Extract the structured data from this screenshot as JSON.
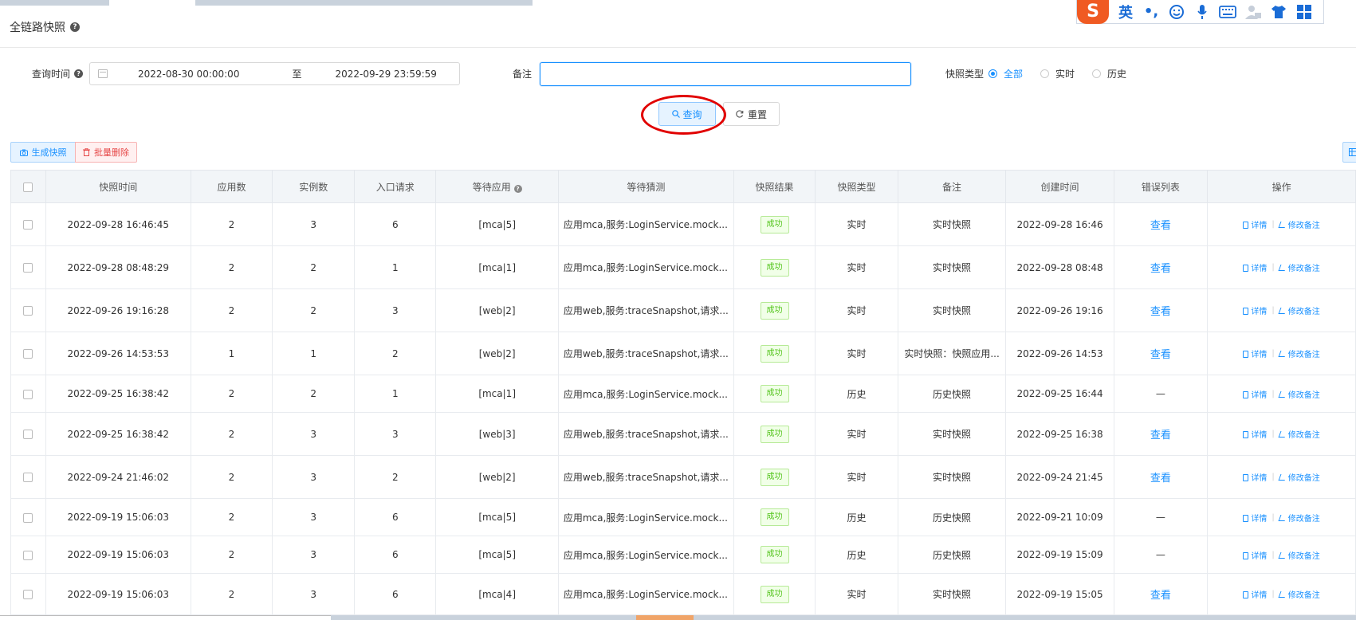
{
  "page": {
    "title": "全链路快照"
  },
  "filters": {
    "time_label": "查询时间",
    "date_start": "2022-08-30 00:00:00",
    "date_sep": "至",
    "date_end": "2022-09-29 23:59:59",
    "remark_label": "备注",
    "remark_value": "",
    "type_label": "快照类型",
    "type_options": [
      "全部",
      "实时",
      "历史"
    ],
    "type_selected": "全部"
  },
  "buttons": {
    "query": "查询",
    "reset": "重置",
    "generate": "生成快照",
    "batch_delete": "批量删除"
  },
  "ime": {
    "logo": "S",
    "lang": "英"
  },
  "table": {
    "columns": [
      "快照时间",
      "应用数",
      "实例数",
      "入口请求",
      "等待应用",
      "等待猜测",
      "快照结果",
      "快照类型",
      "备注",
      "创建时间",
      "错误列表",
      "操作"
    ],
    "ops": {
      "detail": "详情",
      "edit": "修改备注"
    },
    "rows": [
      {
        "time": "2022-09-28 16:46:45",
        "apps": "2",
        "instances": "3",
        "requests": "6",
        "wait_app": "[mca|5]",
        "guess": "应用mca,服务:LoginService.mock...",
        "result": "成功",
        "type": "实时",
        "remark": "实时快照",
        "created": "2022-09-28 16:46",
        "errors": "查看"
      },
      {
        "time": "2022-09-28 08:48:29",
        "apps": "2",
        "instances": "2",
        "requests": "1",
        "wait_app": "[mca|1]",
        "guess": "应用mca,服务:LoginService.mock...",
        "result": "成功",
        "type": "实时",
        "remark": "实时快照",
        "created": "2022-09-28 08:48",
        "errors": "查看"
      },
      {
        "time": "2022-09-26 19:16:28",
        "apps": "2",
        "instances": "2",
        "requests": "3",
        "wait_app": "[web|2]",
        "guess": "应用web,服务:traceSnapshot,请求...",
        "result": "成功",
        "type": "实时",
        "remark": "实时快照",
        "created": "2022-09-26 19:16",
        "errors": "查看"
      },
      {
        "time": "2022-09-26 14:53:53",
        "apps": "1",
        "instances": "1",
        "requests": "2",
        "wait_app": "[web|2]",
        "guess": "应用web,服务:traceSnapshot,请求...",
        "result": "成功",
        "type": "实时",
        "remark": "实时快照：快照应用...",
        "created": "2022-09-26 14:53",
        "errors": "查看"
      },
      {
        "time": "2022-09-25 16:38:42",
        "apps": "2",
        "instances": "2",
        "requests": "1",
        "wait_app": "[mca|1]",
        "guess": "应用mca,服务:LoginService.mock...",
        "result": "成功",
        "type": "历史",
        "remark": "历史快照",
        "created": "2022-09-25 16:44",
        "errors": "—"
      },
      {
        "time": "2022-09-25 16:38:42",
        "apps": "2",
        "instances": "3",
        "requests": "3",
        "wait_app": "[web|3]",
        "guess": "应用web,服务:traceSnapshot,请求...",
        "result": "成功",
        "type": "实时",
        "remark": "实时快照",
        "created": "2022-09-25 16:38",
        "errors": "查看"
      },
      {
        "time": "2022-09-24 21:46:02",
        "apps": "2",
        "instances": "3",
        "requests": "2",
        "wait_app": "[web|2]",
        "guess": "应用web,服务:traceSnapshot,请求...",
        "result": "成功",
        "type": "实时",
        "remark": "实时快照",
        "created": "2022-09-24 21:45",
        "errors": "查看"
      },
      {
        "time": "2022-09-19 15:06:03",
        "apps": "2",
        "instances": "3",
        "requests": "6",
        "wait_app": "[mca|5]",
        "guess": "应用mca,服务:LoginService.mock...",
        "result": "成功",
        "type": "历史",
        "remark": "历史快照",
        "created": "2022-09-21 10:09",
        "errors": "—"
      },
      {
        "time": "2022-09-19 15:06:03",
        "apps": "2",
        "instances": "3",
        "requests": "6",
        "wait_app": "[mca|5]",
        "guess": "应用mca,服务:LoginService.mock...",
        "result": "成功",
        "type": "历史",
        "remark": "历史快照",
        "created": "2022-09-19 15:09",
        "errors": "—"
      },
      {
        "time": "2022-09-19 15:06:03",
        "apps": "2",
        "instances": "3",
        "requests": "6",
        "wait_app": "[mca|4]",
        "guess": "应用mca,服务:LoginService.mock...",
        "result": "成功",
        "type": "实时",
        "remark": "实时快照",
        "created": "2022-09-19 15:05",
        "errors": "查看"
      }
    ]
  }
}
